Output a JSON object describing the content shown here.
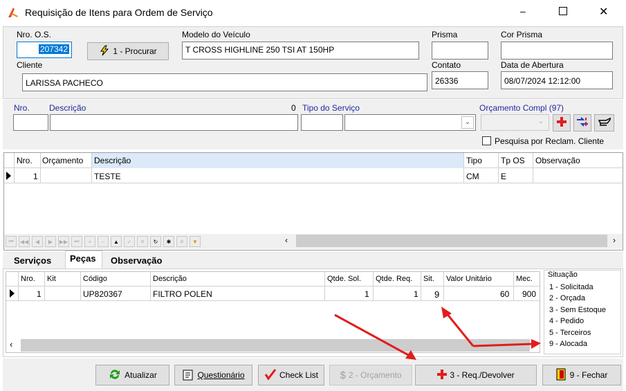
{
  "window": {
    "title": "Requisição de Itens para Ordem de Serviço",
    "icon": "app-icon",
    "minimize": "–",
    "maximize": "□",
    "close": "✕"
  },
  "header": {
    "os_label": "Nro. O.S.",
    "os_value": "207342",
    "procurar": "1 - Procurar",
    "modelo_label": "Modelo do Veículo",
    "modelo_value": "T CROSS HIGHLINE 250 TSI AT 150HP",
    "prisma_label": "Prisma",
    "prisma_value": "",
    "cor_prisma_label": "Cor Prisma",
    "cor_prisma_value": "",
    "cliente_label": "Cliente",
    "cliente_value": "LARISSA PACHECO",
    "contato_label": "Contato",
    "contato_value": "26336",
    "abertura_label": "Data de Abertura",
    "abertura_value": "08/07/2024 12:12:00"
  },
  "filter": {
    "nro_label": "Nro.",
    "descricao_label": "Descrição",
    "count": "0",
    "tipo_servico_label": "Tipo do Serviço",
    "orcamento_label": "Orçamento Compl (97)",
    "pesquisa_label": "Pesquisa por Reclam. Cliente",
    "pesquisa_checked": false
  },
  "services_grid": {
    "headers": [
      "Nro.",
      "Orçamento",
      "Descrição",
      "Tipo",
      "Tp OS",
      "Observação"
    ],
    "rows": [
      {
        "nro": "1",
        "orcamento": "",
        "descricao": "TESTE",
        "tipo": "CM",
        "tp_os": "E",
        "observacao": ""
      }
    ]
  },
  "navigator": [
    "⏮",
    "◀◀",
    "◀",
    "▶",
    "▶▶",
    "⏭",
    "+",
    "−",
    "▲",
    "✓",
    "✕",
    "↻",
    "✱",
    "✳",
    "▼"
  ],
  "tabs": [
    "Serviços",
    "Peças",
    "Observação"
  ],
  "active_tab": "Peças",
  "parts_grid": {
    "headers": [
      "Nro.",
      "Kit",
      "Código",
      "Descrição",
      "Qtde. Sol.",
      "Qtde. Req.",
      "Sit.",
      "Valor Unitário",
      "Mec."
    ],
    "rows": [
      {
        "nro": "1",
        "kit": "",
        "codigo": "UP820367",
        "descricao": "FILTRO POLEN",
        "qtde_sol": "1",
        "qtde_req": "1",
        "sit": "9",
        "valor": "60",
        "mec": "900"
      }
    ]
  },
  "situacao": {
    "title": "Situação",
    "items": [
      "1 - Solicitada",
      "2 - Orçada",
      "3 - Sem Estoque",
      "4 - Pedido",
      "5 - Terceiros",
      "9 - Alocada"
    ]
  },
  "footer": {
    "atualizar": "Atualizar",
    "questionario": "Questionário",
    "checklist": "Check List",
    "orcamento": "2 - Orçamento",
    "req_devolver": "3 - Req./Devolver",
    "fechar": "9 - Fechar"
  },
  "colors": {
    "accent": "#0078d7",
    "annotation": "#e11d1d",
    "label_blue": "#1f2a9e"
  }
}
